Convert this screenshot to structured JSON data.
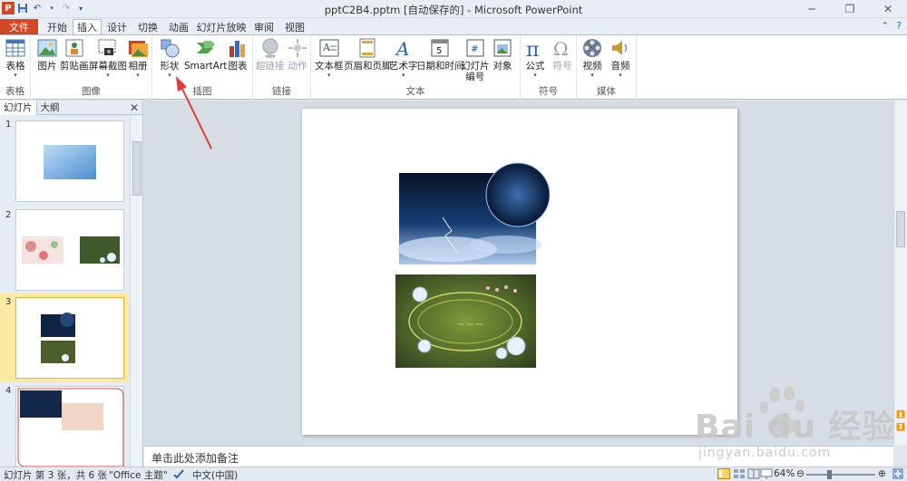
{
  "window": {
    "title": "pptC2B4.pptm [自动保存的] - Microsoft PowerPoint",
    "app_icon_letter": "P"
  },
  "tabs": {
    "file": "文件",
    "items": [
      "开始",
      "插入",
      "设计",
      "切换",
      "动画",
      "幻灯片放映",
      "审阅",
      "视图"
    ],
    "active": "插入"
  },
  "ribbon": {
    "groups": {
      "tables": {
        "label": "表格",
        "table": "表格"
      },
      "images": {
        "label": "图像",
        "picture": "图片",
        "clipart": "剪贴画",
        "screenshot": "屏幕截图",
        "album": "相册"
      },
      "illustrations": {
        "label": "插图",
        "shapes": "形状",
        "smartart": "SmartArt",
        "chart": "图表"
      },
      "links": {
        "label": "链接",
        "hyperlink": "超链接",
        "action": "动作"
      },
      "text": {
        "label": "文本",
        "textbox": "文本框",
        "header_footer": "页眉和页脚",
        "wordart": "艺术字",
        "datetime": "日期和时间",
        "slide_number_1": "幻灯片",
        "slide_number_2": "编号",
        "object": "对象"
      },
      "symbols": {
        "label": "符号",
        "equation": "公式",
        "symbol": "符号"
      },
      "media": {
        "label": "媒体",
        "video": "视频",
        "audio": "音频"
      }
    }
  },
  "leftpane": {
    "tab_slides": "幻灯片",
    "tab_outline": "大纲",
    "slides": [
      {
        "number": "1"
      },
      {
        "number": "2"
      },
      {
        "number": "3",
        "selected": true
      },
      {
        "number": "4"
      }
    ]
  },
  "notes": {
    "placeholder": "单击此处添加备注"
  },
  "watermark": {
    "text": "Bai du 经验",
    "url": "jingyan.baidu.com"
  },
  "status": {
    "slide_info": "幻灯片 第 3 张，共 6 张",
    "theme": "\"Office 主题\"",
    "language": "中文(中国)",
    "zoom": "64%"
  },
  "colors": {
    "file_tab": "#d24726",
    "annotation_arrow": "#e53935",
    "selected_slide": "#fde9a2"
  }
}
